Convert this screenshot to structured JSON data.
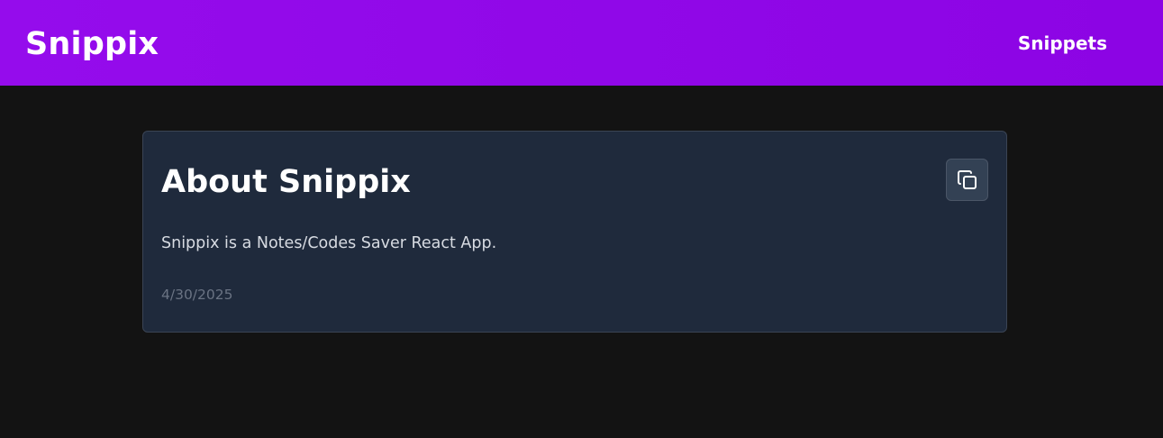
{
  "header": {
    "brand": "Snippix",
    "nav_link": "Snippets"
  },
  "snippet": {
    "title": "About Snippix",
    "content": "Snippix is a Notes/Codes Saver React App.",
    "date": "4/30/2025",
    "copy_icon": "copy-icon"
  },
  "colors": {
    "nav_gradient_start": "#950cec",
    "nav_gradient_end": "#8c04e4",
    "page_background": "#131313",
    "card_background": "#1f2a3c"
  }
}
